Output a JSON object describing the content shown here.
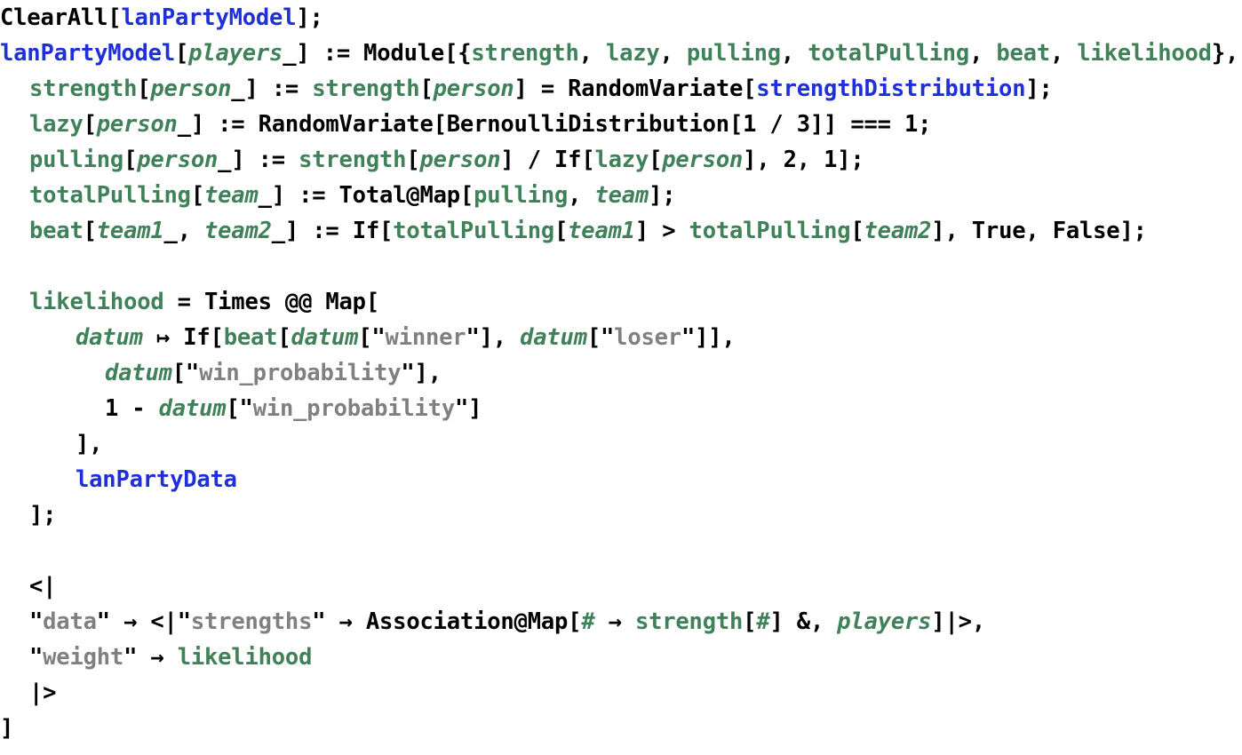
{
  "editor": {
    "language": "Wolfram Language",
    "background_color": "#ffffff",
    "font_size_px": 25.5,
    "line_height_px": 40
  },
  "syntax_colors": {
    "builtin": "#000000",
    "operator": "#000000",
    "bracket": "#000000",
    "number": "#000000",
    "local_symbol": "#3f8159",
    "pattern_variable": "#3f8159",
    "global_symbol": "#2030d8",
    "string_content": "#808080",
    "string_quote": "#000000"
  },
  "code": {
    "lines": [
      {
        "index": 0,
        "indent": 0,
        "text": "ClearAll[lanPartyModel];",
        "tokens": [
          {
            "t": "ClearAll",
            "c": "tok-builtin"
          },
          {
            "t": "[",
            "c": "tok-bracket"
          },
          {
            "t": "lanPartyModel",
            "c": "tok-global"
          },
          {
            "t": "]",
            "c": "tok-bracket"
          },
          {
            "t": ";",
            "c": "tok-op"
          }
        ]
      },
      {
        "index": 1,
        "indent": 0,
        "text": "lanPartyModel[players_] := Module[{strength, lazy, pulling, totalPulling, beat, likelihood},",
        "tokens": [
          {
            "t": "lanPartyModel",
            "c": "tok-global"
          },
          {
            "t": "[",
            "c": "tok-bracket"
          },
          {
            "t": "players",
            "c": "tok-pattern"
          },
          {
            "t": "_",
            "c": "tok-blank"
          },
          {
            "t": "] ",
            "c": "tok-bracket"
          },
          {
            "t": ":= ",
            "c": "tok-op"
          },
          {
            "t": "Module",
            "c": "tok-builtin"
          },
          {
            "t": "[{",
            "c": "tok-bracket"
          },
          {
            "t": "strength",
            "c": "tok-local"
          },
          {
            "t": ", ",
            "c": "tok-op"
          },
          {
            "t": "lazy",
            "c": "tok-local"
          },
          {
            "t": ", ",
            "c": "tok-op"
          },
          {
            "t": "pulling",
            "c": "tok-local"
          },
          {
            "t": ", ",
            "c": "tok-op"
          },
          {
            "t": "totalPulling",
            "c": "tok-local"
          },
          {
            "t": ", ",
            "c": "tok-op"
          },
          {
            "t": "beat",
            "c": "tok-local"
          },
          {
            "t": ", ",
            "c": "tok-op"
          },
          {
            "t": "likelihood",
            "c": "tok-local"
          },
          {
            "t": "}",
            "c": "tok-bracket"
          },
          {
            "t": ",",
            "c": "tok-op"
          }
        ]
      },
      {
        "index": 2,
        "indent": 1,
        "text": "strength[person_] := strength[person] = RandomVariate[strengthDistribution];",
        "tokens": [
          {
            "t": "strength",
            "c": "tok-local"
          },
          {
            "t": "[",
            "c": "tok-bracket"
          },
          {
            "t": "person",
            "c": "tok-pattern"
          },
          {
            "t": "_",
            "c": "tok-blank"
          },
          {
            "t": "] ",
            "c": "tok-bracket"
          },
          {
            "t": ":= ",
            "c": "tok-op"
          },
          {
            "t": "strength",
            "c": "tok-local"
          },
          {
            "t": "[",
            "c": "tok-bracket"
          },
          {
            "t": "person",
            "c": "tok-var"
          },
          {
            "t": "] ",
            "c": "tok-bracket"
          },
          {
            "t": "= ",
            "c": "tok-op"
          },
          {
            "t": "RandomVariate",
            "c": "tok-builtin"
          },
          {
            "t": "[",
            "c": "tok-bracket"
          },
          {
            "t": "strengthDistribution",
            "c": "tok-global"
          },
          {
            "t": "]",
            "c": "tok-bracket"
          },
          {
            "t": ";",
            "c": "tok-op"
          }
        ]
      },
      {
        "index": 3,
        "indent": 1,
        "text": "lazy[person_] := RandomVariate[BernoulliDistribution[1/3]] === 1;",
        "tokens": [
          {
            "t": "lazy",
            "c": "tok-local"
          },
          {
            "t": "[",
            "c": "tok-bracket"
          },
          {
            "t": "person",
            "c": "tok-pattern"
          },
          {
            "t": "_",
            "c": "tok-blank"
          },
          {
            "t": "] ",
            "c": "tok-bracket"
          },
          {
            "t": ":= ",
            "c": "tok-op"
          },
          {
            "t": "RandomVariate",
            "c": "tok-builtin"
          },
          {
            "t": "[",
            "c": "tok-bracket"
          },
          {
            "t": "BernoulliDistribution",
            "c": "tok-builtin"
          },
          {
            "t": "[",
            "c": "tok-bracket"
          },
          {
            "t": "1",
            "c": "tok-num"
          },
          {
            "t": " / ",
            "c": "tok-op"
          },
          {
            "t": "3",
            "c": "tok-num"
          },
          {
            "t": "]] ",
            "c": "tok-bracket"
          },
          {
            "t": "=== ",
            "c": "tok-op"
          },
          {
            "t": "1",
            "c": "tok-num"
          },
          {
            "t": ";",
            "c": "tok-op"
          }
        ]
      },
      {
        "index": 4,
        "indent": 1,
        "text": "pulling[person_] := strength[person] / If[lazy[person], 2, 1];",
        "tokens": [
          {
            "t": "pulling",
            "c": "tok-local"
          },
          {
            "t": "[",
            "c": "tok-bracket"
          },
          {
            "t": "person",
            "c": "tok-pattern"
          },
          {
            "t": "_",
            "c": "tok-blank"
          },
          {
            "t": "] ",
            "c": "tok-bracket"
          },
          {
            "t": ":= ",
            "c": "tok-op"
          },
          {
            "t": "strength",
            "c": "tok-local"
          },
          {
            "t": "[",
            "c": "tok-bracket"
          },
          {
            "t": "person",
            "c": "tok-var"
          },
          {
            "t": "] ",
            "c": "tok-bracket"
          },
          {
            "t": "/ ",
            "c": "tok-op"
          },
          {
            "t": "If",
            "c": "tok-builtin"
          },
          {
            "t": "[",
            "c": "tok-bracket"
          },
          {
            "t": "lazy",
            "c": "tok-local"
          },
          {
            "t": "[",
            "c": "tok-bracket"
          },
          {
            "t": "person",
            "c": "tok-var"
          },
          {
            "t": "]",
            "c": "tok-bracket"
          },
          {
            "t": ", ",
            "c": "tok-op"
          },
          {
            "t": "2",
            "c": "tok-num"
          },
          {
            "t": ", ",
            "c": "tok-op"
          },
          {
            "t": "1",
            "c": "tok-num"
          },
          {
            "t": "]",
            "c": "tok-bracket"
          },
          {
            "t": ";",
            "c": "tok-op"
          }
        ]
      },
      {
        "index": 5,
        "indent": 1,
        "text": "totalPulling[team_] := Total@Map[pulling, team];",
        "tokens": [
          {
            "t": "totalPulling",
            "c": "tok-local"
          },
          {
            "t": "[",
            "c": "tok-bracket"
          },
          {
            "t": "team",
            "c": "tok-pattern"
          },
          {
            "t": "_",
            "c": "tok-blank"
          },
          {
            "t": "] ",
            "c": "tok-bracket"
          },
          {
            "t": ":= ",
            "c": "tok-op"
          },
          {
            "t": "Total",
            "c": "tok-builtin"
          },
          {
            "t": "@",
            "c": "tok-op"
          },
          {
            "t": "Map",
            "c": "tok-builtin"
          },
          {
            "t": "[",
            "c": "tok-bracket"
          },
          {
            "t": "pulling",
            "c": "tok-local"
          },
          {
            "t": ", ",
            "c": "tok-op"
          },
          {
            "t": "team",
            "c": "tok-var"
          },
          {
            "t": "]",
            "c": "tok-bracket"
          },
          {
            "t": ";",
            "c": "tok-op"
          }
        ]
      },
      {
        "index": 6,
        "indent": 1,
        "text": "beat[team1_, team2_] := If[totalPulling[team1] > totalPulling[team2], True, False];",
        "tokens": [
          {
            "t": "beat",
            "c": "tok-local"
          },
          {
            "t": "[",
            "c": "tok-bracket"
          },
          {
            "t": "team1",
            "c": "tok-pattern"
          },
          {
            "t": "_",
            "c": "tok-blank"
          },
          {
            "t": ", ",
            "c": "tok-op"
          },
          {
            "t": "team2",
            "c": "tok-pattern"
          },
          {
            "t": "_",
            "c": "tok-blank"
          },
          {
            "t": "] ",
            "c": "tok-bracket"
          },
          {
            "t": ":= ",
            "c": "tok-op"
          },
          {
            "t": "If",
            "c": "tok-builtin"
          },
          {
            "t": "[",
            "c": "tok-bracket"
          },
          {
            "t": "totalPulling",
            "c": "tok-local"
          },
          {
            "t": "[",
            "c": "tok-bracket"
          },
          {
            "t": "team1",
            "c": "tok-var"
          },
          {
            "t": "] ",
            "c": "tok-bracket"
          },
          {
            "t": "> ",
            "c": "tok-op"
          },
          {
            "t": "totalPulling",
            "c": "tok-local"
          },
          {
            "t": "[",
            "c": "tok-bracket"
          },
          {
            "t": "team2",
            "c": "tok-var"
          },
          {
            "t": "]",
            "c": "tok-bracket"
          },
          {
            "t": ", ",
            "c": "tok-op"
          },
          {
            "t": "True",
            "c": "tok-builtin"
          },
          {
            "t": ", ",
            "c": "tok-op"
          },
          {
            "t": "False",
            "c": "tok-builtin"
          },
          {
            "t": "]",
            "c": "tok-bracket"
          },
          {
            "t": ";",
            "c": "tok-op"
          }
        ]
      },
      {
        "index": 7,
        "indent": 0,
        "text": "",
        "tokens": []
      },
      {
        "index": 8,
        "indent": 1,
        "text": "likelihood = Times @@ Map[",
        "tokens": [
          {
            "t": "likelihood",
            "c": "tok-local"
          },
          {
            "t": " = ",
            "c": "tok-op"
          },
          {
            "t": "Times",
            "c": "tok-builtin"
          },
          {
            "t": " @@ ",
            "c": "tok-op"
          },
          {
            "t": "Map",
            "c": "tok-builtin"
          },
          {
            "t": "[",
            "c": "tok-bracket"
          }
        ]
      },
      {
        "index": 9,
        "indent": 2,
        "text": "datum |-> If[beat[datum[\"winner\"], datum[\"loser\"]],",
        "tokens": [
          {
            "t": "datum",
            "c": "tok-var"
          },
          {
            "t": " ↦ ",
            "c": "tok-op"
          },
          {
            "t": "If",
            "c": "tok-builtin"
          },
          {
            "t": "[",
            "c": "tok-bracket"
          },
          {
            "t": "beat",
            "c": "tok-local"
          },
          {
            "t": "[",
            "c": "tok-bracket"
          },
          {
            "t": "datum",
            "c": "tok-var"
          },
          {
            "t": "[",
            "c": "tok-bracket"
          },
          {
            "t": "\"",
            "c": "tok-quote"
          },
          {
            "t": "winner",
            "c": "tok-string"
          },
          {
            "t": "\"",
            "c": "tok-quote"
          },
          {
            "t": "]",
            "c": "tok-bracket"
          },
          {
            "t": ", ",
            "c": "tok-op"
          },
          {
            "t": "datum",
            "c": "tok-var"
          },
          {
            "t": "[",
            "c": "tok-bracket"
          },
          {
            "t": "\"",
            "c": "tok-quote"
          },
          {
            "t": "loser",
            "c": "tok-string"
          },
          {
            "t": "\"",
            "c": "tok-quote"
          },
          {
            "t": "]]",
            "c": "tok-bracket"
          },
          {
            "t": ",",
            "c": "tok-op"
          }
        ]
      },
      {
        "index": 10,
        "indent": 3,
        "text": "datum[\"win_probability\"],",
        "tokens": [
          {
            "t": "datum",
            "c": "tok-var"
          },
          {
            "t": "[",
            "c": "tok-bracket"
          },
          {
            "t": "\"",
            "c": "tok-quote"
          },
          {
            "t": "win_probability",
            "c": "tok-string"
          },
          {
            "t": "\"",
            "c": "tok-quote"
          },
          {
            "t": "]",
            "c": "tok-bracket"
          },
          {
            "t": ",",
            "c": "tok-op"
          }
        ]
      },
      {
        "index": 11,
        "indent": 3,
        "text": "1 - datum[\"win_probability\"]",
        "tokens": [
          {
            "t": "1",
            "c": "tok-num"
          },
          {
            "t": " - ",
            "c": "tok-op"
          },
          {
            "t": "datum",
            "c": "tok-var"
          },
          {
            "t": "[",
            "c": "tok-bracket"
          },
          {
            "t": "\"",
            "c": "tok-quote"
          },
          {
            "t": "win_probability",
            "c": "tok-string"
          },
          {
            "t": "\"",
            "c": "tok-quote"
          },
          {
            "t": "]",
            "c": "tok-bracket"
          }
        ]
      },
      {
        "index": 12,
        "indent": 2,
        "text": "],",
        "tokens": [
          {
            "t": "]",
            "c": "tok-bracket"
          },
          {
            "t": ",",
            "c": "tok-op"
          }
        ]
      },
      {
        "index": 13,
        "indent": 2,
        "text": "lanPartyData",
        "tokens": [
          {
            "t": "lanPartyData",
            "c": "tok-global"
          }
        ]
      },
      {
        "index": 14,
        "indent": 1,
        "text": "];",
        "tokens": [
          {
            "t": "]",
            "c": "tok-bracket"
          },
          {
            "t": ";",
            "c": "tok-op"
          }
        ]
      },
      {
        "index": 15,
        "indent": 0,
        "text": "",
        "tokens": []
      },
      {
        "index": 16,
        "indent": 1,
        "text": "<|",
        "tokens": [
          {
            "t": "<|",
            "c": "tok-bracket"
          }
        ]
      },
      {
        "index": 17,
        "indent": 1,
        "text": " \"data\" -> <|\"strengths\" -> Association@Map[# -> strength[#] &, players]|>,",
        "tokens": [
          {
            "t": "\"",
            "c": "tok-quote"
          },
          {
            "t": "data",
            "c": "tok-string"
          },
          {
            "t": "\"",
            "c": "tok-quote"
          },
          {
            "t": " → ",
            "c": "tok-op"
          },
          {
            "t": "<|",
            "c": "tok-bracket"
          },
          {
            "t": "\"",
            "c": "tok-quote"
          },
          {
            "t": "strengths",
            "c": "tok-string"
          },
          {
            "t": "\"",
            "c": "tok-quote"
          },
          {
            "t": " → ",
            "c": "tok-op"
          },
          {
            "t": "Association",
            "c": "tok-builtin"
          },
          {
            "t": "@",
            "c": "tok-op"
          },
          {
            "t": "Map",
            "c": "tok-builtin"
          },
          {
            "t": "[",
            "c": "tok-bracket"
          },
          {
            "t": "#",
            "c": "tok-slot"
          },
          {
            "t": " → ",
            "c": "tok-op"
          },
          {
            "t": "strength",
            "c": "tok-local"
          },
          {
            "t": "[",
            "c": "tok-bracket"
          },
          {
            "t": "#",
            "c": "tok-slot"
          },
          {
            "t": "] ",
            "c": "tok-bracket"
          },
          {
            "t": "&",
            "c": "tok-op"
          },
          {
            "t": ", ",
            "c": "tok-op"
          },
          {
            "t": "players",
            "c": "tok-var"
          },
          {
            "t": "]",
            "c": "tok-bracket"
          },
          {
            "t": "|>",
            "c": "tok-bracket"
          },
          {
            "t": ",",
            "c": "tok-op"
          }
        ]
      },
      {
        "index": 18,
        "indent": 1,
        "text": " \"weight\" -> likelihood",
        "tokens": [
          {
            "t": "\"",
            "c": "tok-quote"
          },
          {
            "t": "weight",
            "c": "tok-string"
          },
          {
            "t": "\"",
            "c": "tok-quote"
          },
          {
            "t": " → ",
            "c": "tok-op"
          },
          {
            "t": "likelihood",
            "c": "tok-local"
          }
        ]
      },
      {
        "index": 19,
        "indent": 1,
        "text": "  |>",
        "tokens": [
          {
            "t": "|>",
            "c": "tok-bracket"
          }
        ]
      },
      {
        "index": 20,
        "indent": 0,
        "text": " ]",
        "tokens": [
          {
            "t": "]",
            "c": "tok-bracket"
          }
        ]
      }
    ]
  }
}
